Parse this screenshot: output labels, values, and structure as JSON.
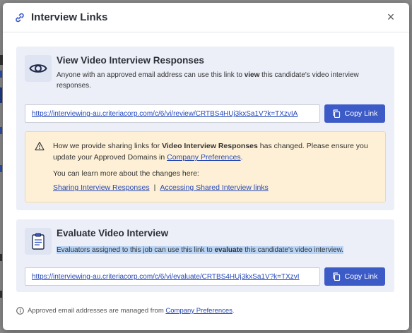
{
  "modal": {
    "title": "Interview Links",
    "close_glyph": "×"
  },
  "view_section": {
    "icon": "eye-icon",
    "title": "View Video Interview Responses",
    "desc_pre": "Anyone with an approved email address can use this link to ",
    "desc_bold": "view",
    "desc_post": " this candidate's video interview responses.",
    "url": "https://interviewing-au.criteriacorp.com/c/6/vi/review/CRTBS4HUj3kxSa1V?k=TXzvIA",
    "copy_label": "Copy Link"
  },
  "warning": {
    "line1_pre": "How we provide sharing links for ",
    "line1_bold": "Video Interview Responses",
    "line1_post": " has changed. Please ensure you update your Approved Domains in ",
    "line1_link": "Company Preferences",
    "line1_end": ".",
    "learn_more": "You can learn more about the changes here:",
    "link_a": "Sharing Interview Responses",
    "separator": "|",
    "link_b": "Accessing Shared Interview links",
    "color_bg": "#fdf0d6"
  },
  "evaluate_section": {
    "icon": "clipboard-icon",
    "title": "Evaluate Video Interview",
    "desc_pre": "Evaluators assigned to this job can use this link to ",
    "desc_bold": "evaluate",
    "desc_post": " this candidate's video interview.",
    "url": "https://interviewing-au.criteriacorp.com/c/6/vi/evaluate/CRTBS4HUj3kxSa1V?k=TXzvI",
    "copy_label": "Copy Link"
  },
  "footer": {
    "text": "Approved email addresses are managed from ",
    "link": "Company Preferences",
    "end": "."
  },
  "colors": {
    "accent": "#3d5bc7",
    "link": "#2548b8",
    "section_bg": "#eceff8"
  }
}
